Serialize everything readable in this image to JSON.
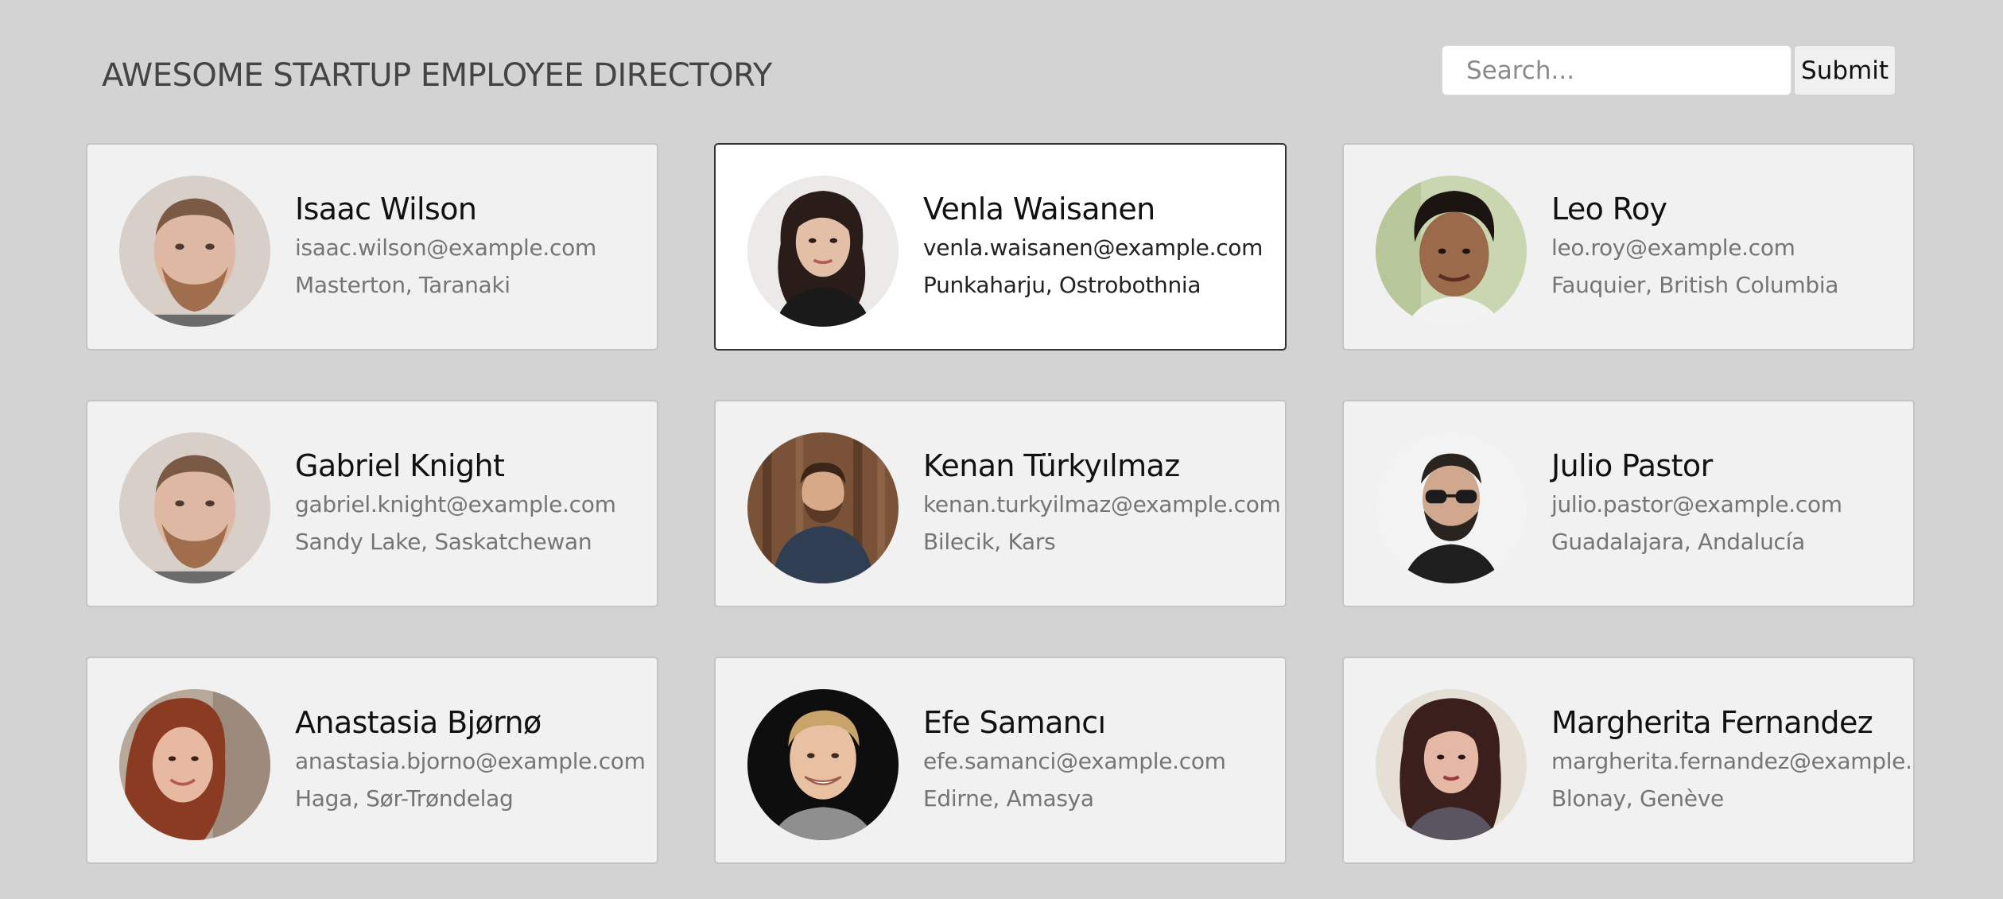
{
  "header": {
    "title": "AWESOME STARTUP EMPLOYEE DIRECTORY"
  },
  "search": {
    "placeholder": "Search...",
    "value": "",
    "submit_label": "Submit"
  },
  "colors": {
    "background": "#d3d3d3",
    "card_background": "#f1f1f1",
    "card_selected_background": "#ffffff",
    "card_border": "#c4c4c4",
    "card_selected_border": "#333333",
    "secondary_text": "#757575"
  },
  "employees": [
    {
      "name": "Isaac Wilson",
      "email": "isaac.wilson@example.com",
      "location": "Masterton, Taranaki",
      "avatar_icon": "avatar-photo"
    },
    {
      "name": "Venla Waisanen",
      "email": "venla.waisanen@example.com",
      "location": "Punkaharju, Ostrobothnia",
      "avatar_icon": "avatar-photo",
      "selected": true
    },
    {
      "name": "Leo Roy",
      "email": "leo.roy@example.com",
      "location": "Fauquier, British Columbia",
      "avatar_icon": "avatar-photo"
    },
    {
      "name": "Gabriel Knight",
      "email": "gabriel.knight@example.com",
      "location": "Sandy Lake, Saskatchewan",
      "avatar_icon": "avatar-photo"
    },
    {
      "name": "Kenan Türkyılmaz",
      "email": "kenan.turkyilmaz@example.com",
      "location": "Bilecik, Kars",
      "avatar_icon": "avatar-photo"
    },
    {
      "name": "Julio Pastor",
      "email": "julio.pastor@example.com",
      "location": "Guadalajara, Andalucía",
      "avatar_icon": "avatar-photo"
    },
    {
      "name": "Anastasia Bjørnø",
      "email": "anastasia.bjorno@example.com",
      "location": "Haga, Sør-Trøndelag",
      "avatar_icon": "avatar-photo"
    },
    {
      "name": "Efe Samancı",
      "email": "efe.samanci@example.com",
      "location": "Edirne, Amasya",
      "avatar_icon": "avatar-photo"
    },
    {
      "name": "Margherita Fernandez",
      "email": "margherita.fernandez@example.com",
      "location": "Blonay, Genève",
      "avatar_icon": "avatar-photo"
    }
  ]
}
